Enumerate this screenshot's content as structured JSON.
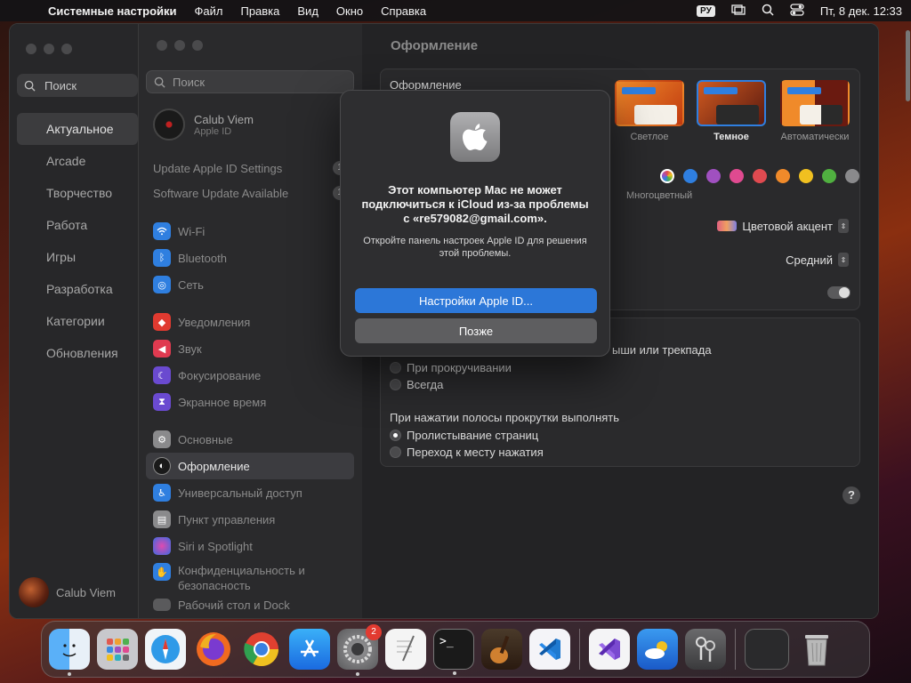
{
  "menubar": {
    "app_name": "Системные настройки",
    "menus": [
      "Файл",
      "Правка",
      "Вид",
      "Окно",
      "Справка"
    ],
    "keyboard_layout": "РУ",
    "datetime": "Пт, 8 дек.  12:33"
  },
  "back_window": {
    "search_placeholder": "Поиск",
    "nav": [
      "Актуальное",
      "Arcade",
      "Творчество",
      "Работа",
      "Игры",
      "Разработка",
      "Категории",
      "Обновления"
    ],
    "active_nav": "Актуальное",
    "user_name": "Calub Viem"
  },
  "sidebar": {
    "search_placeholder": "Поиск",
    "user_name": "Calub Viem",
    "user_sub": "Apple ID",
    "notices": [
      {
        "label": "Update Apple ID Settings",
        "count": "1"
      },
      {
        "label": "Software Update Available",
        "count": "1"
      }
    ],
    "group1": [
      {
        "label": "Wi-Fi",
        "icon": "wifi-icon",
        "color": "#2f7fe0"
      },
      {
        "label": "Bluetooth",
        "icon": "bluetooth-icon",
        "color": "#2f7fe0"
      },
      {
        "label": "Сеть",
        "icon": "globe-icon",
        "color": "#2f7fe0"
      }
    ],
    "group2": [
      {
        "label": "Уведомления",
        "icon": "bell-icon",
        "color": "#e03a30"
      },
      {
        "label": "Звук",
        "icon": "speaker-icon",
        "color": "#e03a50"
      },
      {
        "label": "Фокусирование",
        "icon": "moon-icon",
        "color": "#6a4ad0"
      },
      {
        "label": "Экранное время",
        "icon": "hourglass-icon",
        "color": "#6a4ad0"
      }
    ],
    "group3": [
      {
        "label": "Основные",
        "icon": "gear-icon",
        "color": "#8a8a8c"
      },
      {
        "label": "Оформление",
        "icon": "appearance-icon",
        "color": "#1a1a1a",
        "active": true
      },
      {
        "label": "Универсальный доступ",
        "icon": "accessibility-icon",
        "color": "#2f7fe0"
      },
      {
        "label": "Пункт управления",
        "icon": "control-center-icon",
        "color": "#8a8a8c"
      },
      {
        "label": "Siri и Spotlight",
        "icon": "siri-icon",
        "color": "#b040c0"
      },
      {
        "label": "Конфиденциальность и безопасность",
        "icon": "hand-icon",
        "color": "#2f7fe0"
      }
    ],
    "truncated_item": "Рабочий стол и Dock"
  },
  "main": {
    "title": "Оформление",
    "section_label": "Оформление",
    "themes": [
      {
        "label": "Светлое",
        "selected": false
      },
      {
        "label": "Темное",
        "selected": true
      },
      {
        "label": "Автоматически",
        "selected": false
      }
    ],
    "accent_colors": [
      "#multi",
      "#2f7fe0",
      "#a050c0",
      "#e04a90",
      "#e04a50",
      "#f08a2a",
      "#f0c020",
      "#50b040",
      "#8a8a8c"
    ],
    "multicolor_label": "Многоцветный",
    "highlight_value": "Цветовой акцент",
    "sidebar_size_value": "Средний",
    "scroll_label_partial": "ыши или трекпада",
    "show_scrollbars_options": [
      {
        "label": "При прокручивании",
        "checked": false
      },
      {
        "label": "Всегда",
        "checked": false
      }
    ],
    "click_scrollbar_label": "При нажатии полосы прокрутки выполнять",
    "click_options": [
      {
        "label": "Пролистывание страниц",
        "checked": true
      },
      {
        "label": "Переход к месту нажатия",
        "checked": false
      }
    ],
    "help_label": "?"
  },
  "dialog": {
    "message": "Этот компьютер Mac не может подключиться к iCloud из-за проблемы с «re579082@gmail.com».",
    "info": "Откройте панель настроек Apple ID для решения этой проблемы.",
    "primary_button": "Настройки Apple ID...",
    "secondary_button": "Позже"
  },
  "dock": {
    "apps": [
      {
        "name": "finder-icon",
        "color": "#3a8ef0",
        "running": true
      },
      {
        "name": "launchpad-icon",
        "color": "#c8c8cc",
        "running": false
      },
      {
        "name": "safari-icon",
        "color": "#2f9ae8",
        "running": false
      },
      {
        "name": "firefox-icon",
        "color": "#f06a20",
        "running": false
      },
      {
        "name": "chrome-icon",
        "color": "#e8e8e8",
        "running": false
      },
      {
        "name": "app-store-icon",
        "color": "#2f8ae8",
        "running": false
      },
      {
        "name": "system-settings-icon",
        "color": "#7a7a7c",
        "running": true,
        "badge": "2"
      },
      {
        "name": "textedit-icon",
        "color": "#f0f0f0",
        "running": false
      },
      {
        "name": "terminal-icon",
        "color": "#1a1a1a",
        "running": true
      },
      {
        "name": "garageband-icon",
        "color": "#3a2a20",
        "running": false
      },
      {
        "name": "vscode-icon",
        "color": "#1f7ad0",
        "running": false
      }
    ],
    "apps2": [
      {
        "name": "visual-studio-icon",
        "color": "#f0f0f2",
        "running": false
      },
      {
        "name": "weather-icon",
        "color": "#3a8ae0",
        "running": false
      },
      {
        "name": "keychain-icon",
        "color": "#5a5a5c",
        "running": false
      }
    ],
    "trash_items": [
      {
        "name": "screen-preview-icon",
        "color": "#2a2a2c"
      },
      {
        "name": "trash-icon",
        "color": "#c8c8c8"
      }
    ]
  }
}
